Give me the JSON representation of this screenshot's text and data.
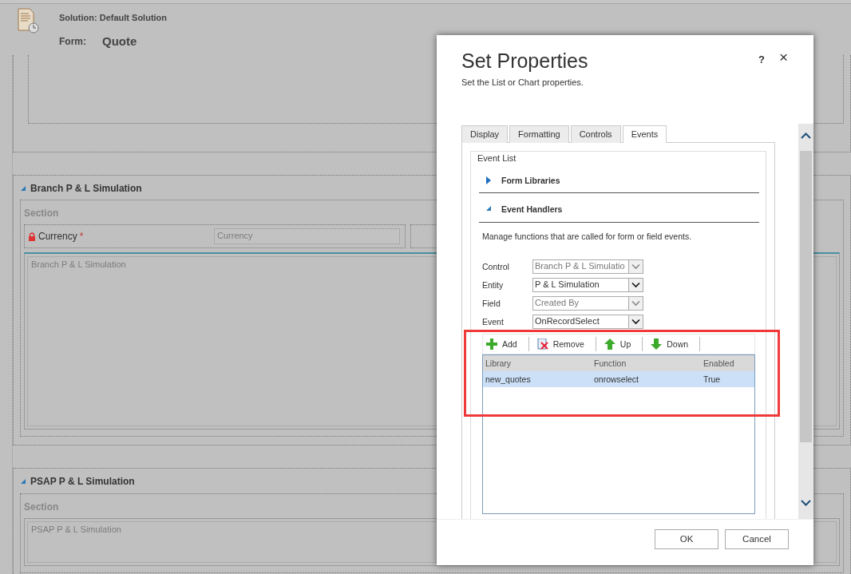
{
  "page": {
    "solution": "Solution: Default Solution",
    "form_label": "Form:",
    "form_name": "Quote",
    "sections": [
      {
        "title": "Branch P & L Simulation",
        "expanded": true,
        "section_label": "Section",
        "fields": [
          {
            "label": "Currency",
            "locked": true,
            "required_mark": "*",
            "placeholder": "Currency"
          }
        ],
        "subgrid": "Branch P & L Simulation"
      },
      {
        "title": "PSAP P & L Simulation",
        "expanded": true,
        "section_label": "Section",
        "subgrid": "PSAP P & L Simulation"
      }
    ]
  },
  "dialog": {
    "title": "Set Properties",
    "subtitle": "Set the List or Chart properties.",
    "help": "?",
    "close": "×",
    "tabs": [
      {
        "label": "Display",
        "selected": false
      },
      {
        "label": "Formatting",
        "selected": false
      },
      {
        "label": "Controls",
        "selected": false
      },
      {
        "label": "Events",
        "selected": true
      }
    ],
    "event_list": {
      "legend": "Event List",
      "groups": [
        {
          "title": "Form Libraries",
          "expanded": false
        },
        {
          "title": "Event Handlers",
          "expanded": true
        }
      ],
      "description": "Manage functions that are called for form or field events.",
      "fields": [
        {
          "label": "Control",
          "value": "Branch P & L Simulatio",
          "disabled": true
        },
        {
          "label": "Entity",
          "value": "P & L Simulation",
          "disabled": false
        },
        {
          "label": "Field",
          "value": "Created By",
          "disabled": true
        },
        {
          "label": "Event",
          "value": "OnRecordSelect",
          "disabled": false
        }
      ],
      "toolbar": [
        {
          "kind": "add",
          "label": "Add"
        },
        {
          "kind": "remove",
          "label": "Remove"
        },
        {
          "kind": "up",
          "label": "Up"
        },
        {
          "kind": "down",
          "label": "Down"
        }
      ],
      "table": {
        "columns": [
          "Library",
          "Function",
          "Enabled"
        ],
        "rows": [
          {
            "cells": [
              "new_quotes",
              "onrowselect",
              "True"
            ],
            "selected": true
          }
        ]
      }
    },
    "buttons": [
      "OK",
      "Cancel"
    ]
  },
  "annotation": {
    "kind": "highlight"
  }
}
